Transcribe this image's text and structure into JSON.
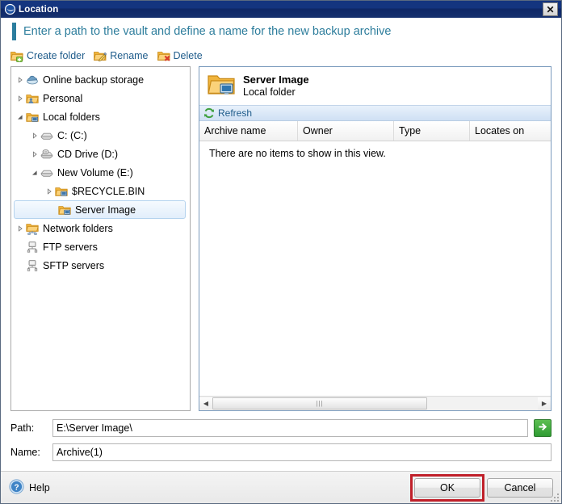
{
  "window": {
    "title": "Location",
    "logo_icon": "acronis-logo-icon",
    "close_label": "✕"
  },
  "banner": {
    "text": "Enter a path to the vault and define a name for the new backup archive",
    "accent_color": "#2b7d9e"
  },
  "toolbar": {
    "items": [
      {
        "label": "Create folder",
        "icon": "folder-add-icon"
      },
      {
        "label": "Rename",
        "icon": "folder-rename-icon"
      },
      {
        "label": "Delete",
        "icon": "folder-delete-icon"
      }
    ]
  },
  "tree": {
    "nodes": [
      {
        "label": "Online backup storage",
        "icon": "cloud-storage-icon",
        "indent": 1,
        "twisty": "collapsed",
        "selected": false
      },
      {
        "label": "Personal",
        "icon": "personal-folder-icon",
        "indent": 1,
        "twisty": "collapsed",
        "selected": false
      },
      {
        "label": "Local folders",
        "icon": "local-folder-icon",
        "indent": 1,
        "twisty": "expanded",
        "selected": false
      },
      {
        "label": "C: (C:)",
        "icon": "drive-icon",
        "indent": 2,
        "twisty": "collapsed",
        "selected": false
      },
      {
        "label": "CD Drive (D:)",
        "icon": "cd-drive-icon",
        "indent": 2,
        "twisty": "collapsed",
        "selected": false
      },
      {
        "label": "New Volume (E:)",
        "icon": "drive-icon",
        "indent": 2,
        "twisty": "expanded",
        "selected": false
      },
      {
        "label": "$RECYCLE.BIN",
        "icon": "local-folder-icon",
        "indent": 3,
        "twisty": "collapsed",
        "selected": false
      },
      {
        "label": "Server Image",
        "icon": "local-folder-icon",
        "indent": 3,
        "twisty": "none",
        "selected": true
      },
      {
        "label": "Network folders",
        "icon": "network-folder-icon",
        "indent": 1,
        "twisty": "collapsed",
        "selected": false
      },
      {
        "label": "FTP servers",
        "icon": "server-icon",
        "indent": 1,
        "twisty": "none",
        "selected": false
      },
      {
        "label": "SFTP servers",
        "icon": "server-icon",
        "indent": 1,
        "twisty": "none",
        "selected": false
      }
    ]
  },
  "details": {
    "header": {
      "icon": "local-folder-large-icon",
      "title": "Server Image",
      "subtitle": "Local folder"
    },
    "refresh": {
      "label": "Refresh",
      "icon": "refresh-icon"
    },
    "columns": [
      {
        "label": "Archive name",
        "width": 122
      },
      {
        "label": "Owner",
        "width": 119
      },
      {
        "label": "Type",
        "width": 94
      },
      {
        "label": "Locates on",
        "width": 100
      }
    ],
    "empty_message": "There are no items to show in this view.",
    "scrollbar": {
      "left_arrow": "◀",
      "right_arrow": "▶",
      "grip": "|||"
    }
  },
  "fields": {
    "path": {
      "label": "Path:",
      "value": "E:\\Server Image\\",
      "placeholder": ""
    },
    "name": {
      "label": "Name:",
      "value": "Archive(1)",
      "placeholder": ""
    },
    "go_button": {
      "icon": "arrow-right-icon"
    }
  },
  "footer": {
    "help": {
      "label": "Help",
      "icon": "help-icon"
    },
    "ok_label": "OK",
    "cancel_label": "Cancel",
    "highlight_color": "#c0202a"
  }
}
